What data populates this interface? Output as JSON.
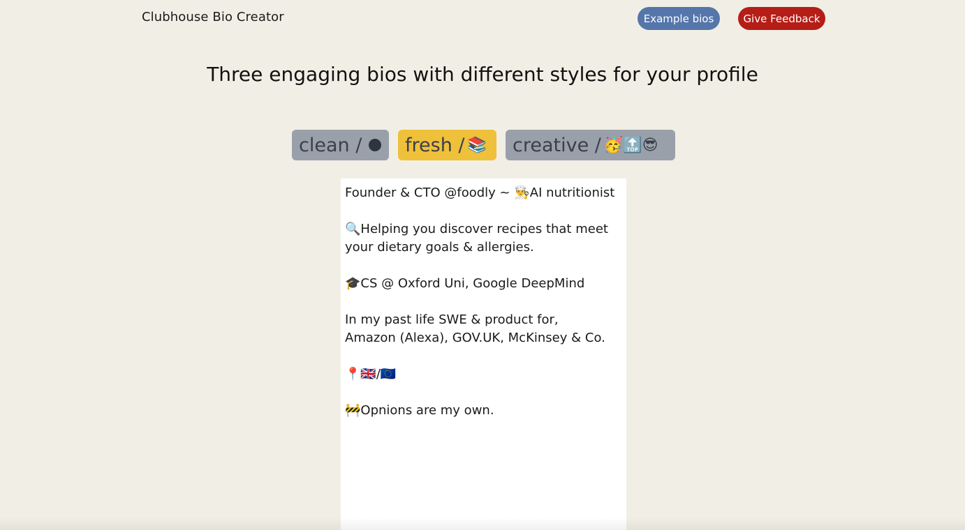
{
  "header": {
    "brand": "Clubhouse Bio Creator",
    "example_bios": "Example bios",
    "give_feedback": "Give Feedback"
  },
  "headline": "Three engaging bios with different styles for your profile",
  "tabs": [
    {
      "label": "clean /",
      "emoji": ""
    },
    {
      "label": "fresh /",
      "emoji": "📚"
    },
    {
      "label": "creative /",
      "emoji": "🥳🔝😎"
    }
  ],
  "bio": {
    "text": "Founder & CTO @foodly ~ 👨‍🍳AI nutritionist\n\n🔍Helping you discover recipes that meet your dietary goals & allergies.\n\n🎓CS @ Oxford Uni, Google DeepMind\n\nIn my past life SWE & product for,\nAmazon (Alexa), GOV.UK, McKinsey & Co.\n\n📍🇬🇧/🇪🇺\n\n🚧Opnions are my own."
  },
  "colors": {
    "background": "#f1efe5",
    "example_button": "#5576aa",
    "feedback_button": "#b51d17",
    "tab_inactive": "#9aa0aa",
    "tab_active": "#efc03a"
  }
}
